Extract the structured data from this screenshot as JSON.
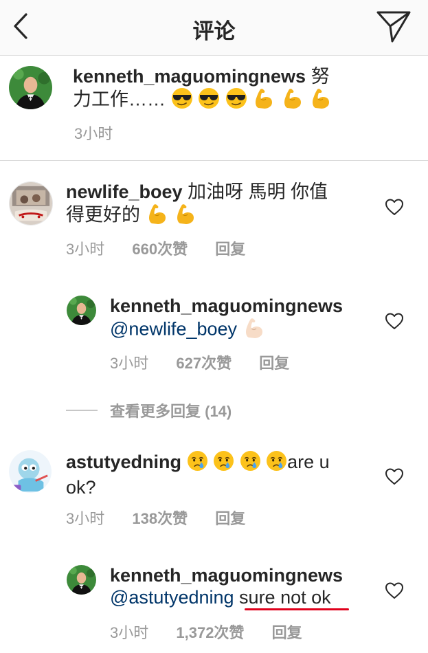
{
  "header": {
    "title": "评论"
  },
  "caption": {
    "username": "kenneth_maguomingnews",
    "text_line1": "努",
    "text_line2": "力工作……",
    "time": "3小时"
  },
  "comments": [
    {
      "username": "newlife_boey",
      "text_line1": "加油呀 馬明 你值",
      "text_line2": "得更好的",
      "time": "3小时",
      "likes": "660次赞",
      "reply": "回复"
    },
    {
      "username": "kenneth_maguomingnews",
      "mention": "@newlife_boey",
      "time": "3小时",
      "likes": "627次赞",
      "reply": "回复"
    },
    {
      "username": "astutyedning",
      "text_line1": "are u",
      "text_line2": "ok?",
      "time": "3小时",
      "likes": "138次赞",
      "reply": "回复"
    },
    {
      "username": "kenneth_maguomingnews",
      "mention": "@astutyedning",
      "text": "sure not ok",
      "time": "3小时",
      "likes": "1,372次赞",
      "reply": "回复"
    }
  ],
  "view_more_replies": "查看更多回复 (14)",
  "colors": {
    "mention": "#003569",
    "annotation_underline": "#e0001b",
    "muted_text": "#999999"
  },
  "icons": [
    "back-arrow-icon",
    "direct-send-icon",
    "heart-icon",
    "sunglasses-emoji",
    "flexed-biceps-emoji",
    "crying-face-emoji"
  ]
}
